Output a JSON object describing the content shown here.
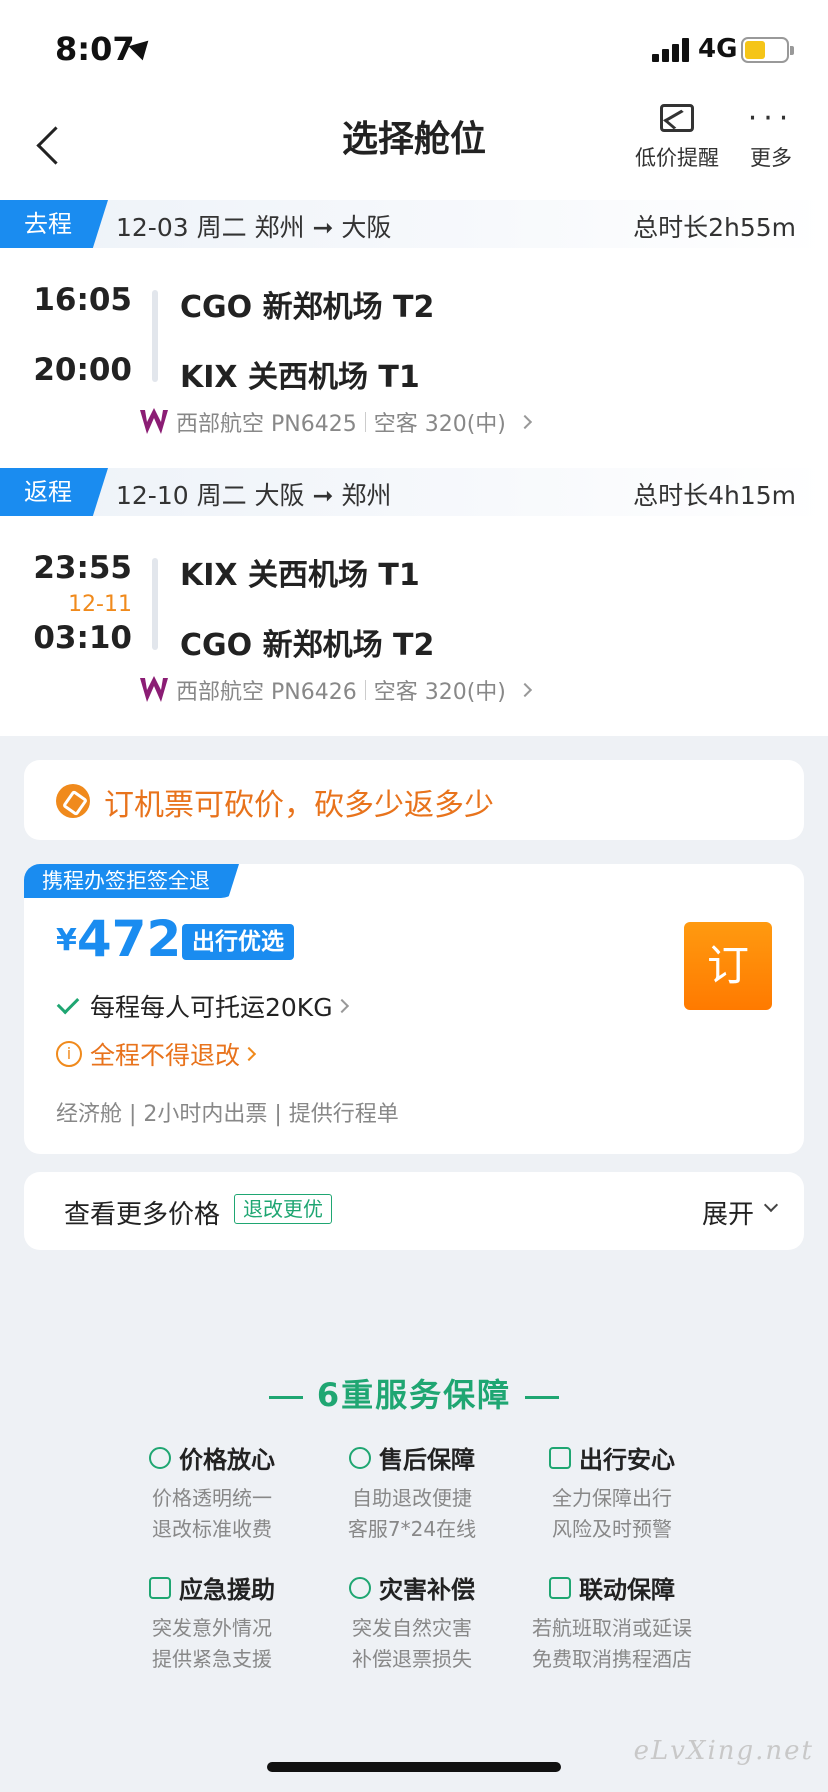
{
  "status_bar": {
    "time": "8:07",
    "network": "4G"
  },
  "header": {
    "title": "选择舱位",
    "price_alert_label": "低价提醒",
    "more_label": "更多"
  },
  "outbound": {
    "tag": "去程",
    "route": "12-03 周二 郑州 ➞ 大阪",
    "duration": "总时长2h55m",
    "dep_time": "16:05",
    "dep_airport": "CGO 新郑机场 T2",
    "arr_time": "20:00",
    "arr_airport": "KIX 关西机场 T1",
    "airline": "西部航空 PN6425",
    "aircraft": "空客 320(中)"
  },
  "return": {
    "tag": "返程",
    "route": "12-10 周二 大阪 ➞ 郑州",
    "duration": "总时长4h15m",
    "dep_time": "23:55",
    "dep_airport": "KIX 关西机场 T1",
    "next_day": "12-11",
    "arr_time": "03:10",
    "arr_airport": "CGO 新郑机场 T2",
    "airline": "西部航空 PN6426",
    "aircraft": "空客 320(中)"
  },
  "promo": {
    "text": "订机票可砍价，砍多少返多少"
  },
  "fare": {
    "badge": "携程办签拒签全退",
    "currency": "¥",
    "price": "472",
    "tag": "出行优选",
    "baggage": "每程每人可托运20KG",
    "refund_rule": "全程不得退改",
    "meta": "经济舱 | 2小时内出票 | 提供行程单",
    "book_label": "订"
  },
  "more_prices": {
    "label": "查看更多价格",
    "tag": "退改更优",
    "expand_label": "展开"
  },
  "guarantees": {
    "title": "6重服务保障",
    "items": [
      {
        "title": "价格放心",
        "line1": "价格透明统一",
        "line2": "退改标准收费",
        "icon": "yuan-icon"
      },
      {
        "title": "售后保障",
        "line1": "自助退改便捷",
        "line2": "客服7*24在线",
        "icon": "headset-icon"
      },
      {
        "title": "出行安心",
        "line1": "全力保障出行",
        "line2": "风险及时预警",
        "icon": "suitcase-icon"
      },
      {
        "title": "应急援助",
        "line1": "突发意外情况",
        "line2": "提供紧急支援",
        "icon": "alarm-icon"
      },
      {
        "title": "灾害补偿",
        "line1": "突发自然灾害",
        "line2": "补偿退票损失",
        "icon": "umbrella-icon"
      },
      {
        "title": "联动保障",
        "line1": "若航班取消或延误",
        "line2": "免费取消携程酒店",
        "icon": "shield-check-icon"
      }
    ]
  },
  "watermark": "eLvXing.net",
  "colors": {
    "accent": "#1a8cf0",
    "orange": "#ff7a00",
    "green": "#1fa672"
  }
}
